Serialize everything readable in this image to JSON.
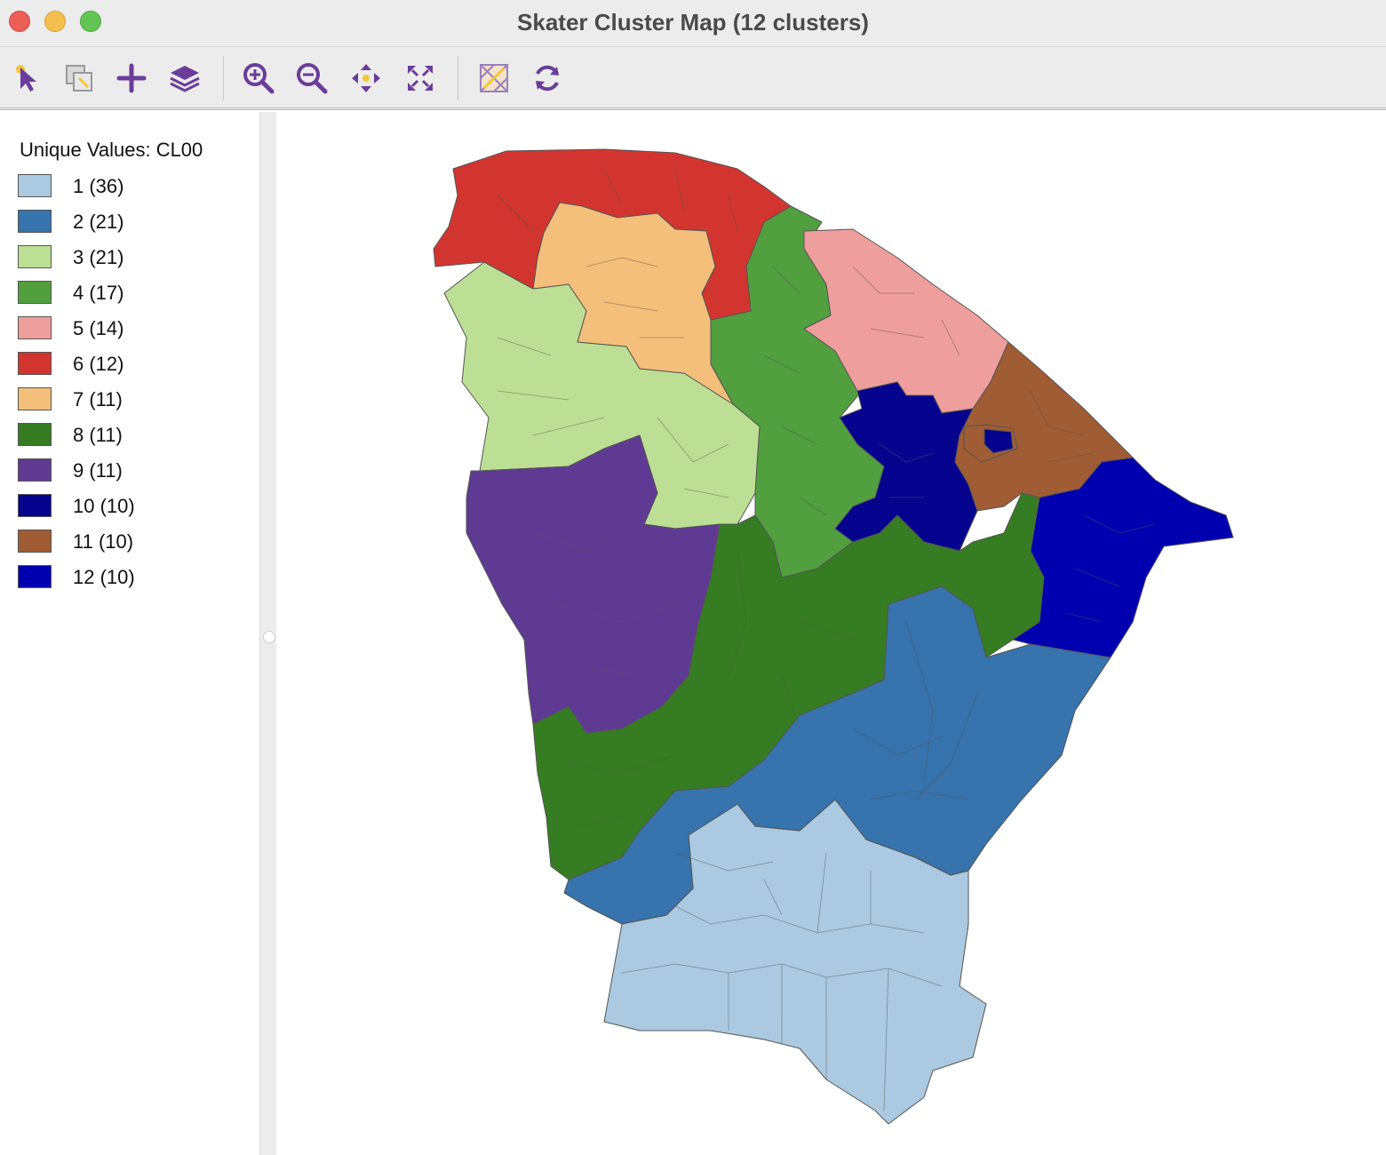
{
  "window": {
    "title": "Skater Cluster Map (12 clusters)"
  },
  "toolbar": {
    "tools": [
      {
        "name": "select-tool-icon"
      },
      {
        "name": "selection-shape-icon"
      },
      {
        "name": "add-icon"
      },
      {
        "name": "layers-icon"
      },
      {
        "name": "zoom-in-icon"
      },
      {
        "name": "zoom-out-icon"
      },
      {
        "name": "pan-icon"
      },
      {
        "name": "full-extent-icon"
      },
      {
        "name": "basemap-icon"
      },
      {
        "name": "refresh-icon"
      }
    ]
  },
  "legend": {
    "title": "Unique Values: CL00",
    "items": [
      {
        "label": "1 (36)",
        "color": "#abc9e0"
      },
      {
        "label": "2 (21)",
        "color": "#3773ac"
      },
      {
        "label": "3 (21)",
        "color": "#bddf95"
      },
      {
        "label": "4 (17)",
        "color": "#519f3f"
      },
      {
        "label": "5 (14)",
        "color": "#ee9e9c"
      },
      {
        "label": "6 (12)",
        "color": "#d2352f"
      },
      {
        "label": "7 (11)",
        "color": "#f4be7b"
      },
      {
        "label": "8 (11)",
        "color": "#367c22"
      },
      {
        "label": "9 (11)",
        "color": "#5f3a93"
      },
      {
        "label": "10 (10)",
        "color": "#06038f"
      },
      {
        "label": "11 (10)",
        "color": "#a05c34"
      },
      {
        "label": "12 (10)",
        "color": "#0000b0"
      }
    ]
  }
}
